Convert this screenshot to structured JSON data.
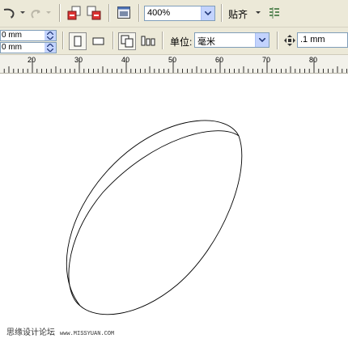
{
  "toolbar1": {
    "undo_icon": "undo-icon",
    "redo_icon": "redo-icon",
    "import_icon": "import-icon",
    "export_icon": "export-icon",
    "app_launcher_icon": "application-launcher-icon",
    "zoom_value": "400%",
    "snap_label": "贴齐",
    "options_icon": "options-icon"
  },
  "toolbar2": {
    "width_value": "0 mm",
    "height_value": "0 mm",
    "portrait_icon": "portrait-icon",
    "landscape_icon": "landscape-icon",
    "all_pages_icon": "all-pages-icon",
    "current_page_icon": "current-page-icon",
    "units_label": "单位:",
    "units_value": "毫米",
    "nudge_icon": "nudge-icon",
    "nudge_value": ".1 mm"
  },
  "ruler": {
    "labels": [
      "20",
      "30",
      "40",
      "50",
      "60",
      "70",
      "80"
    ]
  },
  "watermark": {
    "text": "思缘设计论坛",
    "url": "www.MISSYUAN.COM"
  }
}
